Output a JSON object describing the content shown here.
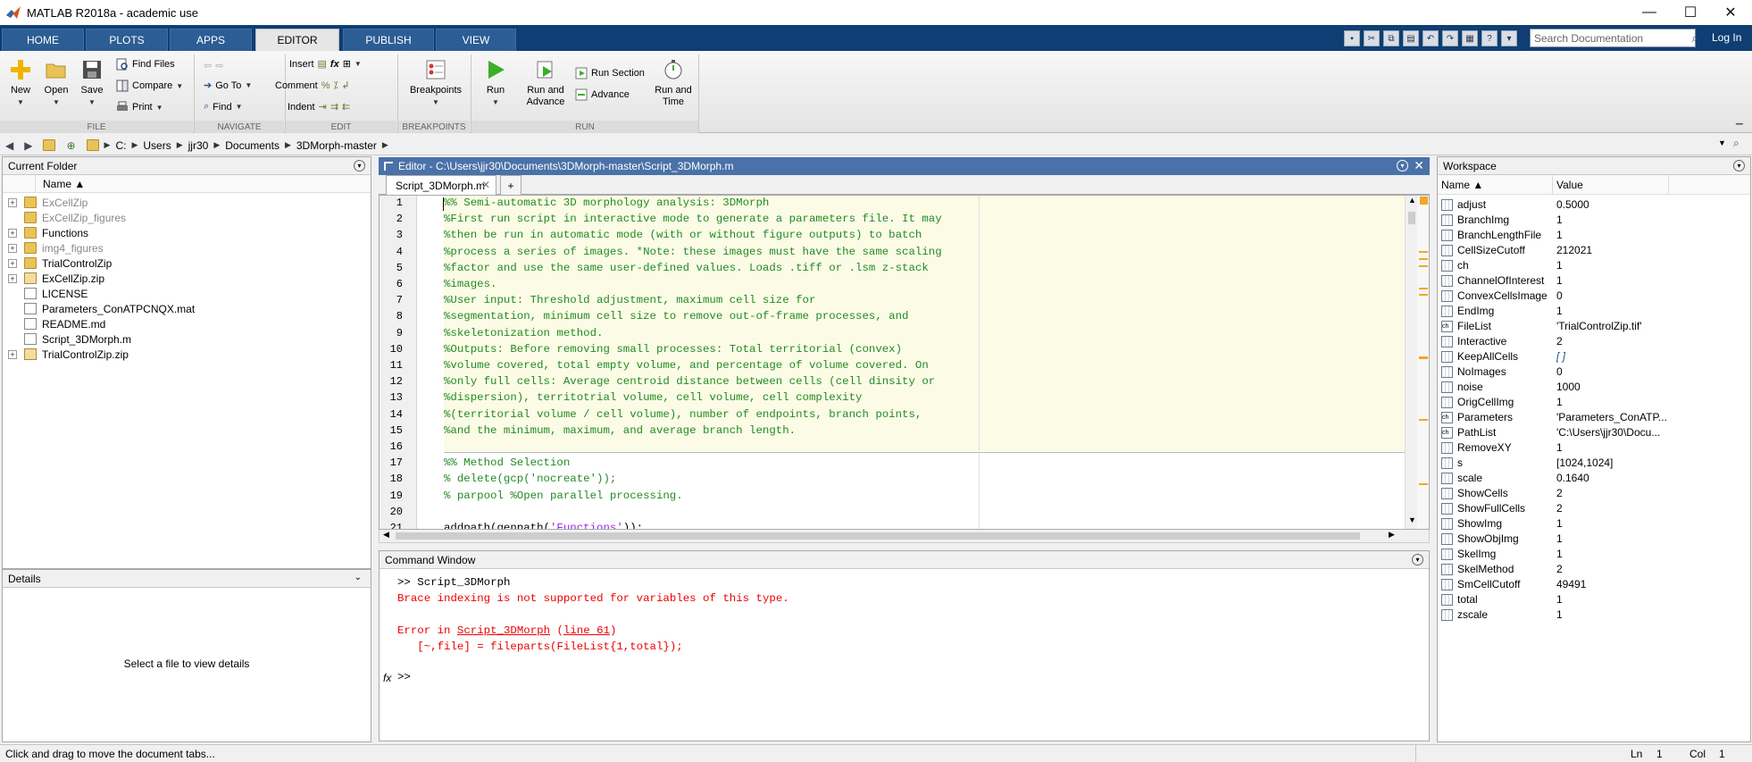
{
  "window": {
    "title": "MATLAB R2018a - academic use",
    "controls": [
      "—",
      "☐",
      "✕"
    ]
  },
  "ribbon_tabs": [
    "HOME",
    "PLOTS",
    "APPS",
    "EDITOR",
    "PUBLISH",
    "VIEW"
  ],
  "active_tab": "EDITOR",
  "search": {
    "placeholder": "Search Documentation"
  },
  "login_label": "Log In",
  "ribbon": {
    "file": {
      "new": "New",
      "open": "Open",
      "save": "Save",
      "find_files": "Find Files",
      "compare": "Compare",
      "print": "Print",
      "label": "FILE"
    },
    "navigate": {
      "goto": "Go To",
      "find": "Find",
      "label": "NAVIGATE"
    },
    "edit": {
      "insert": "Insert",
      "comment": "Comment",
      "indent": "Indent",
      "label": "EDIT"
    },
    "breakpoints": {
      "button": "Breakpoints",
      "label": "BREAKPOINTS"
    },
    "run": {
      "run": "Run",
      "run_advance": "Run and\nAdvance",
      "run_section": "Run Section",
      "advance": "Advance",
      "run_time": "Run and\nTime",
      "label": "RUN"
    }
  },
  "path": [
    "C:",
    "Users",
    "jjr30",
    "Documents",
    "3DMorph-master"
  ],
  "current_folder": {
    "title": "Current Folder",
    "col_name": "Name ▲",
    "items": [
      {
        "name": "ExCellZip",
        "type": "folder",
        "expandable": true,
        "dim": true
      },
      {
        "name": "ExCellZip_figures",
        "type": "folder",
        "expandable": false,
        "dim": true
      },
      {
        "name": "Functions",
        "type": "folder",
        "expandable": true,
        "dim": false
      },
      {
        "name": "img4_figures",
        "type": "folder",
        "expandable": true,
        "dim": true
      },
      {
        "name": "TrialControlZip",
        "type": "folder",
        "expandable": true,
        "dim": false
      },
      {
        "name": "ExCellZip.zip",
        "type": "zip",
        "expandable": true,
        "dim": false
      },
      {
        "name": "LICENSE",
        "type": "file",
        "expandable": false,
        "dim": false
      },
      {
        "name": "Parameters_ConATPCNQX.mat",
        "type": "mat",
        "expandable": false,
        "dim": false
      },
      {
        "name": "README.md",
        "type": "file",
        "expandable": false,
        "dim": false
      },
      {
        "name": "Script_3DMorph.m",
        "type": "mfile",
        "expandable": false,
        "dim": false
      },
      {
        "name": "TrialControlZip.zip",
        "type": "zip",
        "expandable": true,
        "dim": false
      }
    ]
  },
  "details": {
    "title": "Details",
    "empty_text": "Select a file to view details"
  },
  "editor": {
    "title": "Editor - C:\\Users\\jjr30\\Documents\\3DMorph-master\\Script_3DMorph.m",
    "tab": "Script_3DMorph.m",
    "lines": [
      {
        "n": "1",
        "segs": [
          [
            "cm",
            "%% Semi-automatic 3D morphology analysis: 3DMorph"
          ]
        ]
      },
      {
        "n": "2",
        "segs": [
          [
            "cm",
            "%First run script in interactive mode to generate a parameters file. It may"
          ]
        ]
      },
      {
        "n": "3",
        "segs": [
          [
            "cm",
            "%then be run in automatic mode (with or without figure outputs) to batch"
          ]
        ]
      },
      {
        "n": "4",
        "segs": [
          [
            "cm",
            "%process a series of images. *Note: these images must have the same scaling"
          ]
        ]
      },
      {
        "n": "5",
        "segs": [
          [
            "cm",
            "%factor and use the same user-defined values. Loads .tiff or .lsm z-stack"
          ]
        ]
      },
      {
        "n": "6",
        "segs": [
          [
            "cm",
            "%images."
          ]
        ]
      },
      {
        "n": "7",
        "segs": [
          [
            "cm",
            "%User input: Threshold adjustment, maximum cell size for"
          ]
        ]
      },
      {
        "n": "8",
        "segs": [
          [
            "cm",
            "%segmentation, minimum cell size to remove out-of-frame processes, and"
          ]
        ]
      },
      {
        "n": "9",
        "segs": [
          [
            "cm",
            "%skeletonization method."
          ]
        ]
      },
      {
        "n": "10",
        "segs": [
          [
            "cm",
            "%Outputs: Before removing small processes: Total territorial (convex)"
          ]
        ]
      },
      {
        "n": "11",
        "segs": [
          [
            "cm",
            "%volume covered, total empty volume, and percentage of volume covered. On"
          ]
        ]
      },
      {
        "n": "12",
        "segs": [
          [
            "cm",
            "%only full cells: Average centroid distance between cells (cell dinsity or"
          ]
        ]
      },
      {
        "n": "13",
        "segs": [
          [
            "cm",
            "%dispersion), territotrial volume, cell volume, cell complexity"
          ]
        ]
      },
      {
        "n": "14",
        "segs": [
          [
            "cm",
            "%(territorial volume / cell volume), number of endpoints, branch points,"
          ]
        ]
      },
      {
        "n": "15",
        "segs": [
          [
            "cm",
            "%and the minimum, maximum, and average branch length."
          ]
        ]
      },
      {
        "n": "16",
        "segs": [
          [
            "kw",
            ""
          ]
        ]
      },
      {
        "n": "17",
        "segs": [
          [
            "cm",
            "%% Method Selection"
          ]
        ]
      },
      {
        "n": "18",
        "segs": [
          [
            "cm",
            "% delete(gcp('nocreate'));"
          ]
        ]
      },
      {
        "n": "19",
        "segs": [
          [
            "cm",
            "% parpool %Open parallel processing."
          ]
        ]
      },
      {
        "n": "20",
        "segs": [
          [
            "kw",
            ""
          ]
        ]
      },
      {
        "n": "21",
        "segs": [
          [
            "kw",
            "addpath(genpath("
          ],
          [
            "str",
            "'Functions'"
          ],
          [
            "kw",
            "));"
          ]
        ]
      }
    ]
  },
  "command_window": {
    "title": "Command Window",
    "prompt_cmd": ">> Script_3DMorph",
    "error_msg": "Brace indexing is not supported for variables of this type.",
    "error_in": "Error in ",
    "error_fn": "Script_3DMorph",
    "error_line": "line 61",
    "error_code": "   [~,file] = fileparts(FileList{1,total});",
    "fx": "fx",
    "prompt": ">>"
  },
  "workspace": {
    "title": "Workspace",
    "col_name": "Name ▲",
    "col_value": "Value",
    "vars": [
      {
        "name": "adjust",
        "value": "0.5000",
        "kind": "num"
      },
      {
        "name": "BranchImg",
        "value": "1",
        "kind": "num"
      },
      {
        "name": "BranchLengthFile",
        "value": "1",
        "kind": "num"
      },
      {
        "name": "CellSizeCutoff",
        "value": "212021",
        "kind": "num"
      },
      {
        "name": "ch",
        "value": "1",
        "kind": "num"
      },
      {
        "name": "ChannelOfInterest",
        "value": "1",
        "kind": "num"
      },
      {
        "name": "ConvexCellsImage",
        "value": "0",
        "kind": "num"
      },
      {
        "name": "EndImg",
        "value": "1",
        "kind": "num"
      },
      {
        "name": "FileList",
        "value": "'TrialControlZip.tif'",
        "kind": "str"
      },
      {
        "name": "Interactive",
        "value": "2",
        "kind": "num"
      },
      {
        "name": "KeepAllCells",
        "value": "[ ]",
        "kind": "empty"
      },
      {
        "name": "NoImages",
        "value": "0",
        "kind": "num"
      },
      {
        "name": "noise",
        "value": "1000",
        "kind": "num"
      },
      {
        "name": "OrigCellImg",
        "value": "1",
        "kind": "num"
      },
      {
        "name": "Parameters",
        "value": "'Parameters_ConATP...",
        "kind": "str"
      },
      {
        "name": "PathList",
        "value": "'C:\\Users\\jjr30\\Docu...",
        "kind": "str"
      },
      {
        "name": "RemoveXY",
        "value": "1",
        "kind": "num"
      },
      {
        "name": "s",
        "value": "[1024,1024]",
        "kind": "num"
      },
      {
        "name": "scale",
        "value": "0.1640",
        "kind": "num"
      },
      {
        "name": "ShowCells",
        "value": "2",
        "kind": "num"
      },
      {
        "name": "ShowFullCells",
        "value": "2",
        "kind": "num"
      },
      {
        "name": "ShowImg",
        "value": "1",
        "kind": "num"
      },
      {
        "name": "ShowObjImg",
        "value": "1",
        "kind": "num"
      },
      {
        "name": "SkelImg",
        "value": "1",
        "kind": "num"
      },
      {
        "name": "SkelMethod",
        "value": "2",
        "kind": "num"
      },
      {
        "name": "SmCellCutoff",
        "value": "49491",
        "kind": "num"
      },
      {
        "name": "total",
        "value": "1",
        "kind": "num"
      },
      {
        "name": "zscale",
        "value": "1",
        "kind": "num"
      }
    ]
  },
  "status": {
    "message": "Click and drag to move the document tabs...",
    "ln_label": "Ln",
    "ln": "1",
    "col_label": "Col",
    "col": "1"
  },
  "colors": {
    "tabstrip": "#0e3e73",
    "editor_header": "#4b72a8",
    "comment": "#228b22",
    "string": "#a020f0",
    "error": "#e00000",
    "cell_bg": "#fbfbe6"
  }
}
